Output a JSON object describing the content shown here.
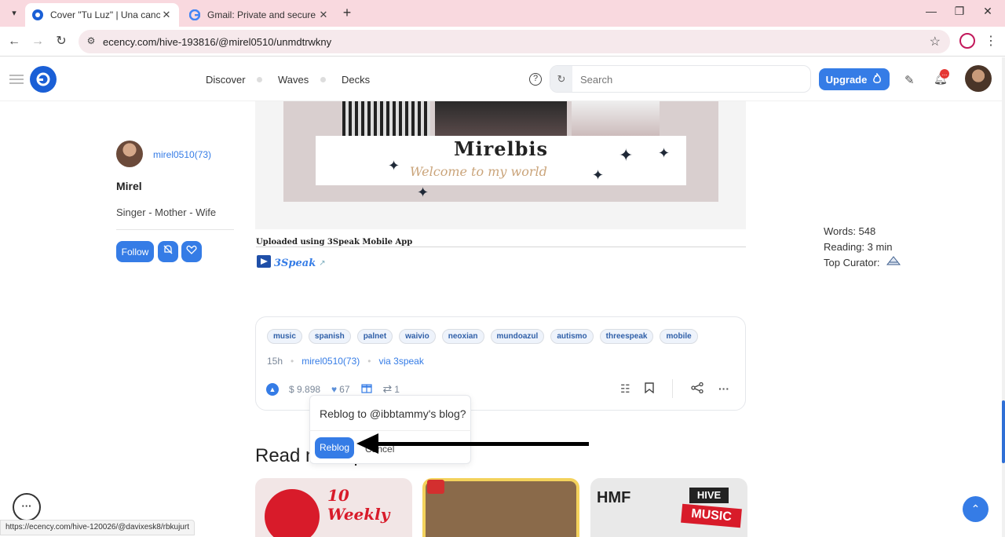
{
  "browser": {
    "tabs": [
      {
        "title": "Cover \"Tu Luz\" | Una canción so",
        "active": true
      },
      {
        "title": "Gmail: Private and secure email",
        "active": false
      }
    ],
    "url": "ecency.com/hive-193816/@mirel0510/unmdtrwkny",
    "status_url": "https://ecency.com/hive-120026/@davixesk8/rbkujurt"
  },
  "header": {
    "nav": [
      "Discover",
      "Waves",
      "Decks"
    ],
    "search_placeholder": "Search",
    "upgrade_label": "Upgrade",
    "notification_badge": "..."
  },
  "author": {
    "handle": "mirel0510(73)",
    "name": "Mirel",
    "bio": "Singer - Mother - Wife",
    "follow_label": "Follow"
  },
  "banner": {
    "title": "Mirelbis",
    "subtitle": "Welcome to my world"
  },
  "post": {
    "uploaded_note": "Uploaded using 3Speak Mobile App",
    "threespeak_label": "3Speak",
    "tags": [
      "music",
      "spanish",
      "palnet",
      "waivio",
      "neoxian",
      "mundoazul",
      "autismo",
      "threespeak",
      "mobile"
    ],
    "age": "15h",
    "author_handle": "mirel0510(73)",
    "via": "via 3speak",
    "payout": "$ 9.898",
    "votes": "67",
    "reblogs": "1"
  },
  "stats": {
    "words": "Words: 548",
    "reading": "Reading: 3 min",
    "curator_label": "Top Curator:"
  },
  "reblog_popover": {
    "question": "Reblog to @ibbtammy's blog?",
    "confirm_label": "Reblog",
    "cancel_label": "Cancel"
  },
  "related": {
    "heading": "Read more posts"
  },
  "colors": {
    "accent": "#357ce6",
    "tabbar": "#f9d9df"
  }
}
